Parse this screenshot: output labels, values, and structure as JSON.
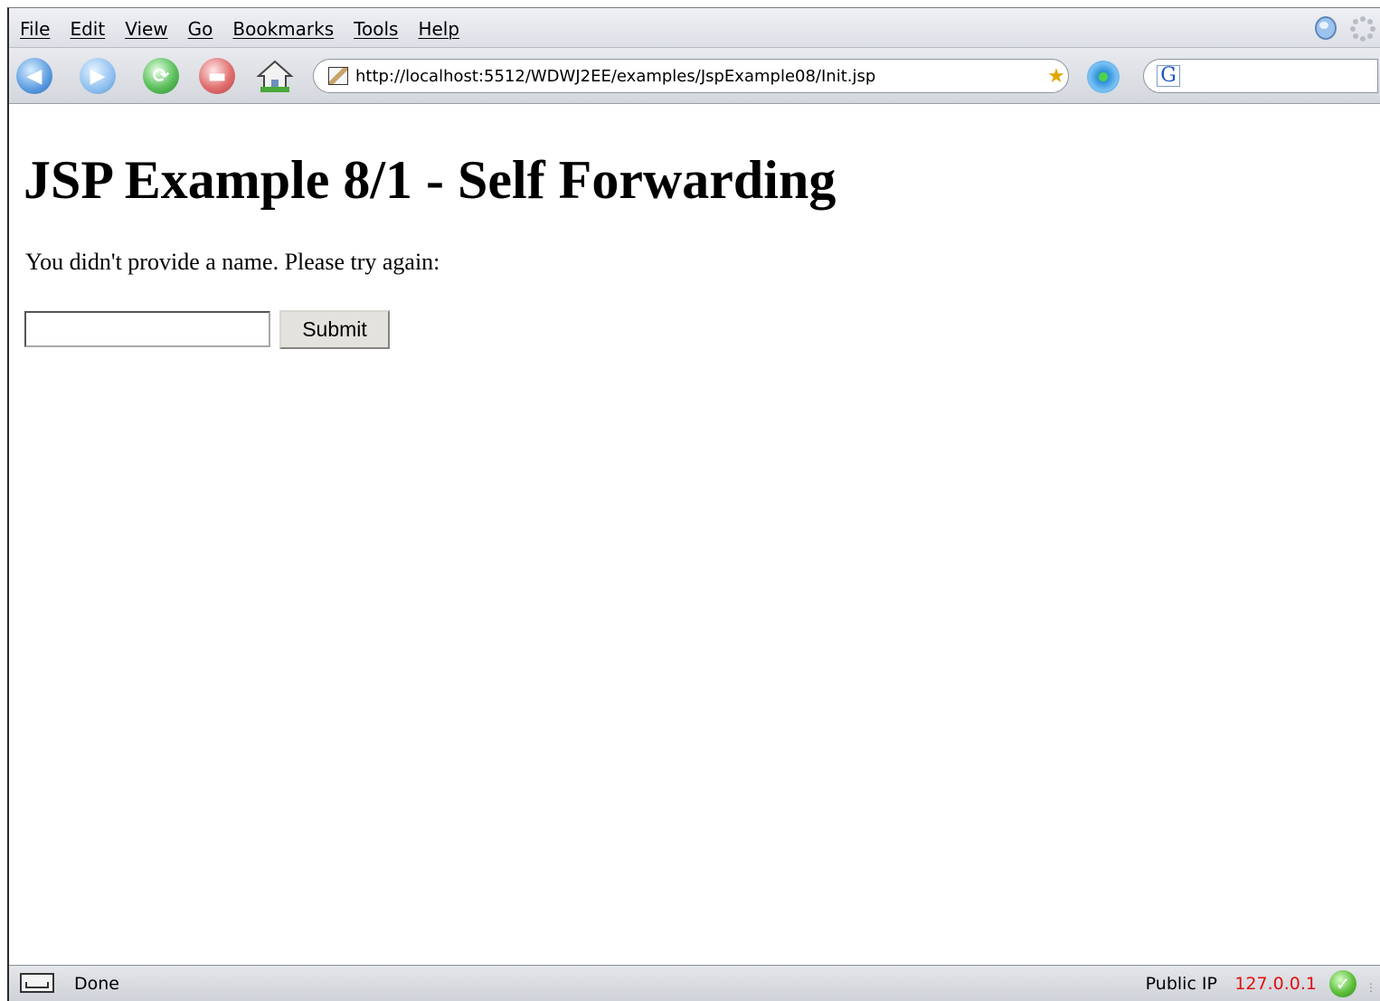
{
  "menu": {
    "items": [
      "File",
      "Edit",
      "View",
      "Go",
      "Bookmarks",
      "Tools",
      "Help"
    ]
  },
  "toolbar": {
    "icons": [
      "back-icon",
      "forward-icon",
      "reload-icon",
      "stop-icon",
      "home-icon"
    ],
    "url": "http://localhost:5512/WDWJ2EE/examples/JspExample08/Init.jsp",
    "search_placeholder": "",
    "search_engine_label": "G"
  },
  "page": {
    "heading": "JSP Example 8/1 - Self Forwarding",
    "message": "You didn't provide a name. Please try again:",
    "name_value": "",
    "submit_label": "Submit"
  },
  "status": {
    "text": "Done",
    "ip_label": "Public IP",
    "ip_value": "127.0.0.1"
  },
  "colors": {
    "ip_value": "#e01010",
    "chrome_bg": "#dde0e6"
  }
}
